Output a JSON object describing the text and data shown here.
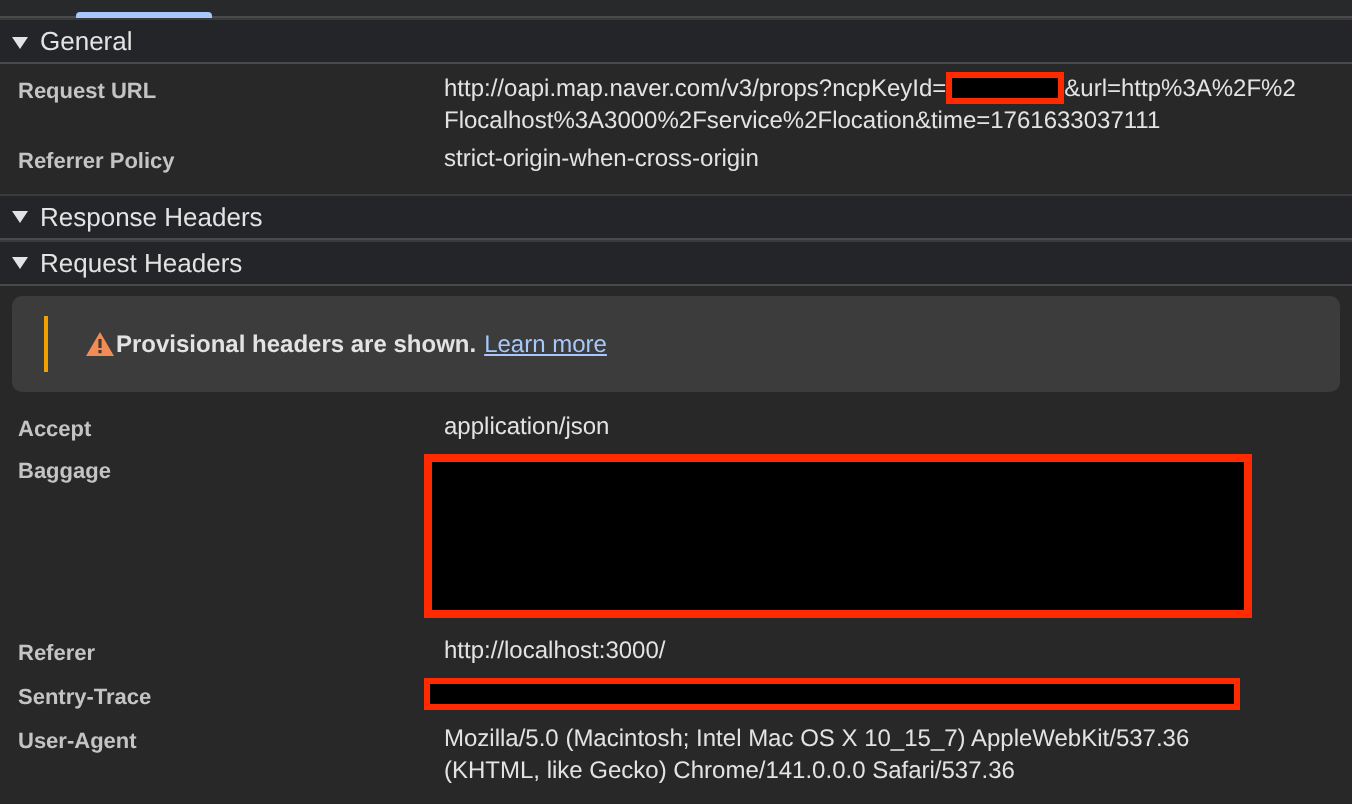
{
  "sections": [
    {
      "title": "General",
      "expanded": true,
      "rows": [
        {
          "name": "Request URL",
          "lines": [
            [
              {
                "kind": "text",
                "text": "http://oapi.map.naver.com/v3/props?ncpKeyId="
              },
              {
                "kind": "redacted-inline"
              },
              {
                "kind": "text",
                "text": "&url=http%3A%2F%2"
              }
            ],
            [
              {
                "kind": "text",
                "text": "Flocalhost%3A3000%2Fservice%2Flocation&time=1761633037111"
              }
            ]
          ]
        },
        {
          "name": "Referrer Policy",
          "lines": [
            [
              {
                "kind": "text",
                "text": "strict-origin-when-cross-origin"
              }
            ]
          ]
        }
      ]
    },
    {
      "title": "Response Headers",
      "expanded": true
    },
    {
      "title": "Request Headers",
      "expanded": true,
      "banner": {
        "message": "Provisional headers are shown.",
        "link": "Learn more"
      },
      "rows": [
        {
          "name": "Accept",
          "lines": [
            [
              {
                "kind": "text",
                "text": "application/json"
              }
            ]
          ]
        },
        {
          "name": "Baggage",
          "lines": [
            [
              {
                "kind": "redacted-block"
              }
            ]
          ]
        },
        {
          "name": "Referer",
          "lines": [
            [
              {
                "kind": "text",
                "text": "http://localhost:3000/"
              }
            ]
          ]
        },
        {
          "name": "Sentry-Trace",
          "lines": [
            [
              {
                "kind": "redacted-bar"
              }
            ]
          ]
        },
        {
          "name": "User-Agent",
          "lines": [
            [
              {
                "kind": "text",
                "text": "Mozilla/5.0 (Macintosh; Intel Mac OS X 10_15_7) AppleWebKit/537.36"
              }
            ],
            [
              {
                "kind": "text",
                "text": "(KHTML, like Gecko) Chrome/141.0.0.0 Safari/537.36"
              }
            ]
          ]
        }
      ]
    }
  ]
}
